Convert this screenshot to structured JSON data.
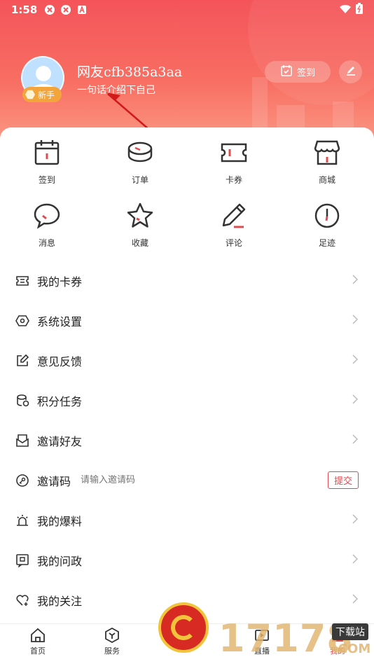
{
  "status_bar": {
    "time": "1:58"
  },
  "profile": {
    "username": "网友cfb385a3aa",
    "bio": "一句话介绍下自己",
    "level_badge": "新手",
    "signin_label": "签到"
  },
  "quick_actions": [
    {
      "label": "签到",
      "icon": "calendar-icon"
    },
    {
      "label": "订单",
      "icon": "order-icon"
    },
    {
      "label": "卡券",
      "icon": "coupon-icon"
    },
    {
      "label": "商城",
      "icon": "store-icon"
    },
    {
      "label": "消息",
      "icon": "message-icon"
    },
    {
      "label": "收藏",
      "icon": "star-icon"
    },
    {
      "label": "评论",
      "icon": "pen-icon"
    },
    {
      "label": "足迹",
      "icon": "clock-icon"
    }
  ],
  "menu": {
    "my_coupons": "我的卡券",
    "settings": "系统设置",
    "feedback": "意见反馈",
    "points_tasks": "积分任务",
    "invite_friends": "邀请好友",
    "invite_code": "邀请码",
    "invite_placeholder": "请输入邀请码",
    "submit": "提交",
    "my_tips": "我的爆料",
    "my_inquiries": "我的问政",
    "my_follows": "我的关注"
  },
  "bottom_nav": {
    "home": "首页",
    "service": "服务",
    "live": "直播",
    "mine": "我的"
  },
  "watermark": {
    "text": "17178",
    "tag": "下载站",
    "suffix": ".COM"
  },
  "colors": {
    "brand": "#e04b4f",
    "header_top": "#f4545a",
    "header_bottom": "#fb9a86"
  }
}
